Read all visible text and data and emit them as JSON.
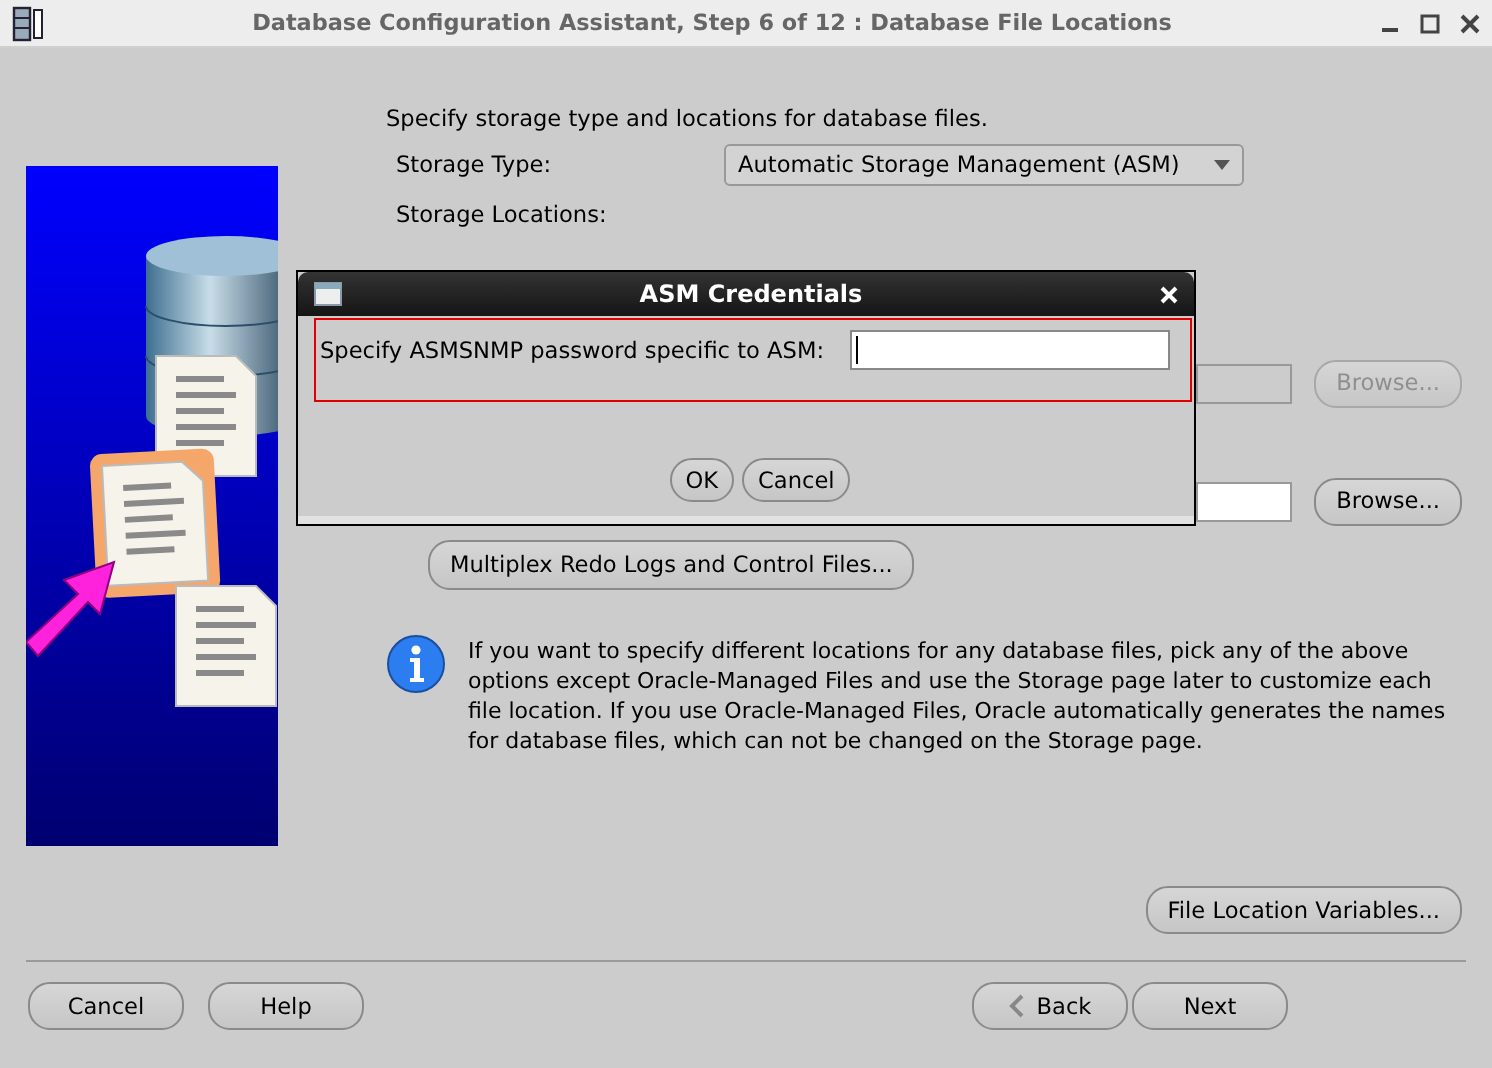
{
  "window": {
    "title": "Database Configuration Assistant, Step 6 of 12 : Database File Locations"
  },
  "instructions": "Specify storage type and locations for database files.",
  "storage_type": {
    "label": "Storage Type:",
    "value": "Automatic Storage Management (ASM)"
  },
  "storage_locations": {
    "label": "Storage Locations:"
  },
  "location_rows": [
    {
      "disabled": true,
      "browse": "Browse..."
    },
    {
      "disabled": false,
      "browse": "Browse..."
    }
  ],
  "multiplex_button": "Multiplex Redo Logs and Control Files...",
  "info_text": "If you want to specify different locations for any database files, pick any of the above options except Oracle-Managed Files and use the Storage page later to customize each file location. If you use Oracle-Managed Files, Oracle automatically generates the names for database files, which can not be changed on the Storage page.",
  "file_location_variables_button": "File Location Variables...",
  "nav_buttons": [
    {
      "label": "Cancel",
      "kind": "plain"
    },
    {
      "label": "Help",
      "kind": "plain"
    },
    {
      "label": "Back",
      "kind": "back"
    },
    {
      "label": "Next",
      "kind": "plain"
    }
  ],
  "dialog": {
    "title": "ASM Credentials",
    "prompt": "Specify ASMSNMP password specific to ASM:",
    "buttons": [
      "OK",
      "Cancel"
    ]
  }
}
